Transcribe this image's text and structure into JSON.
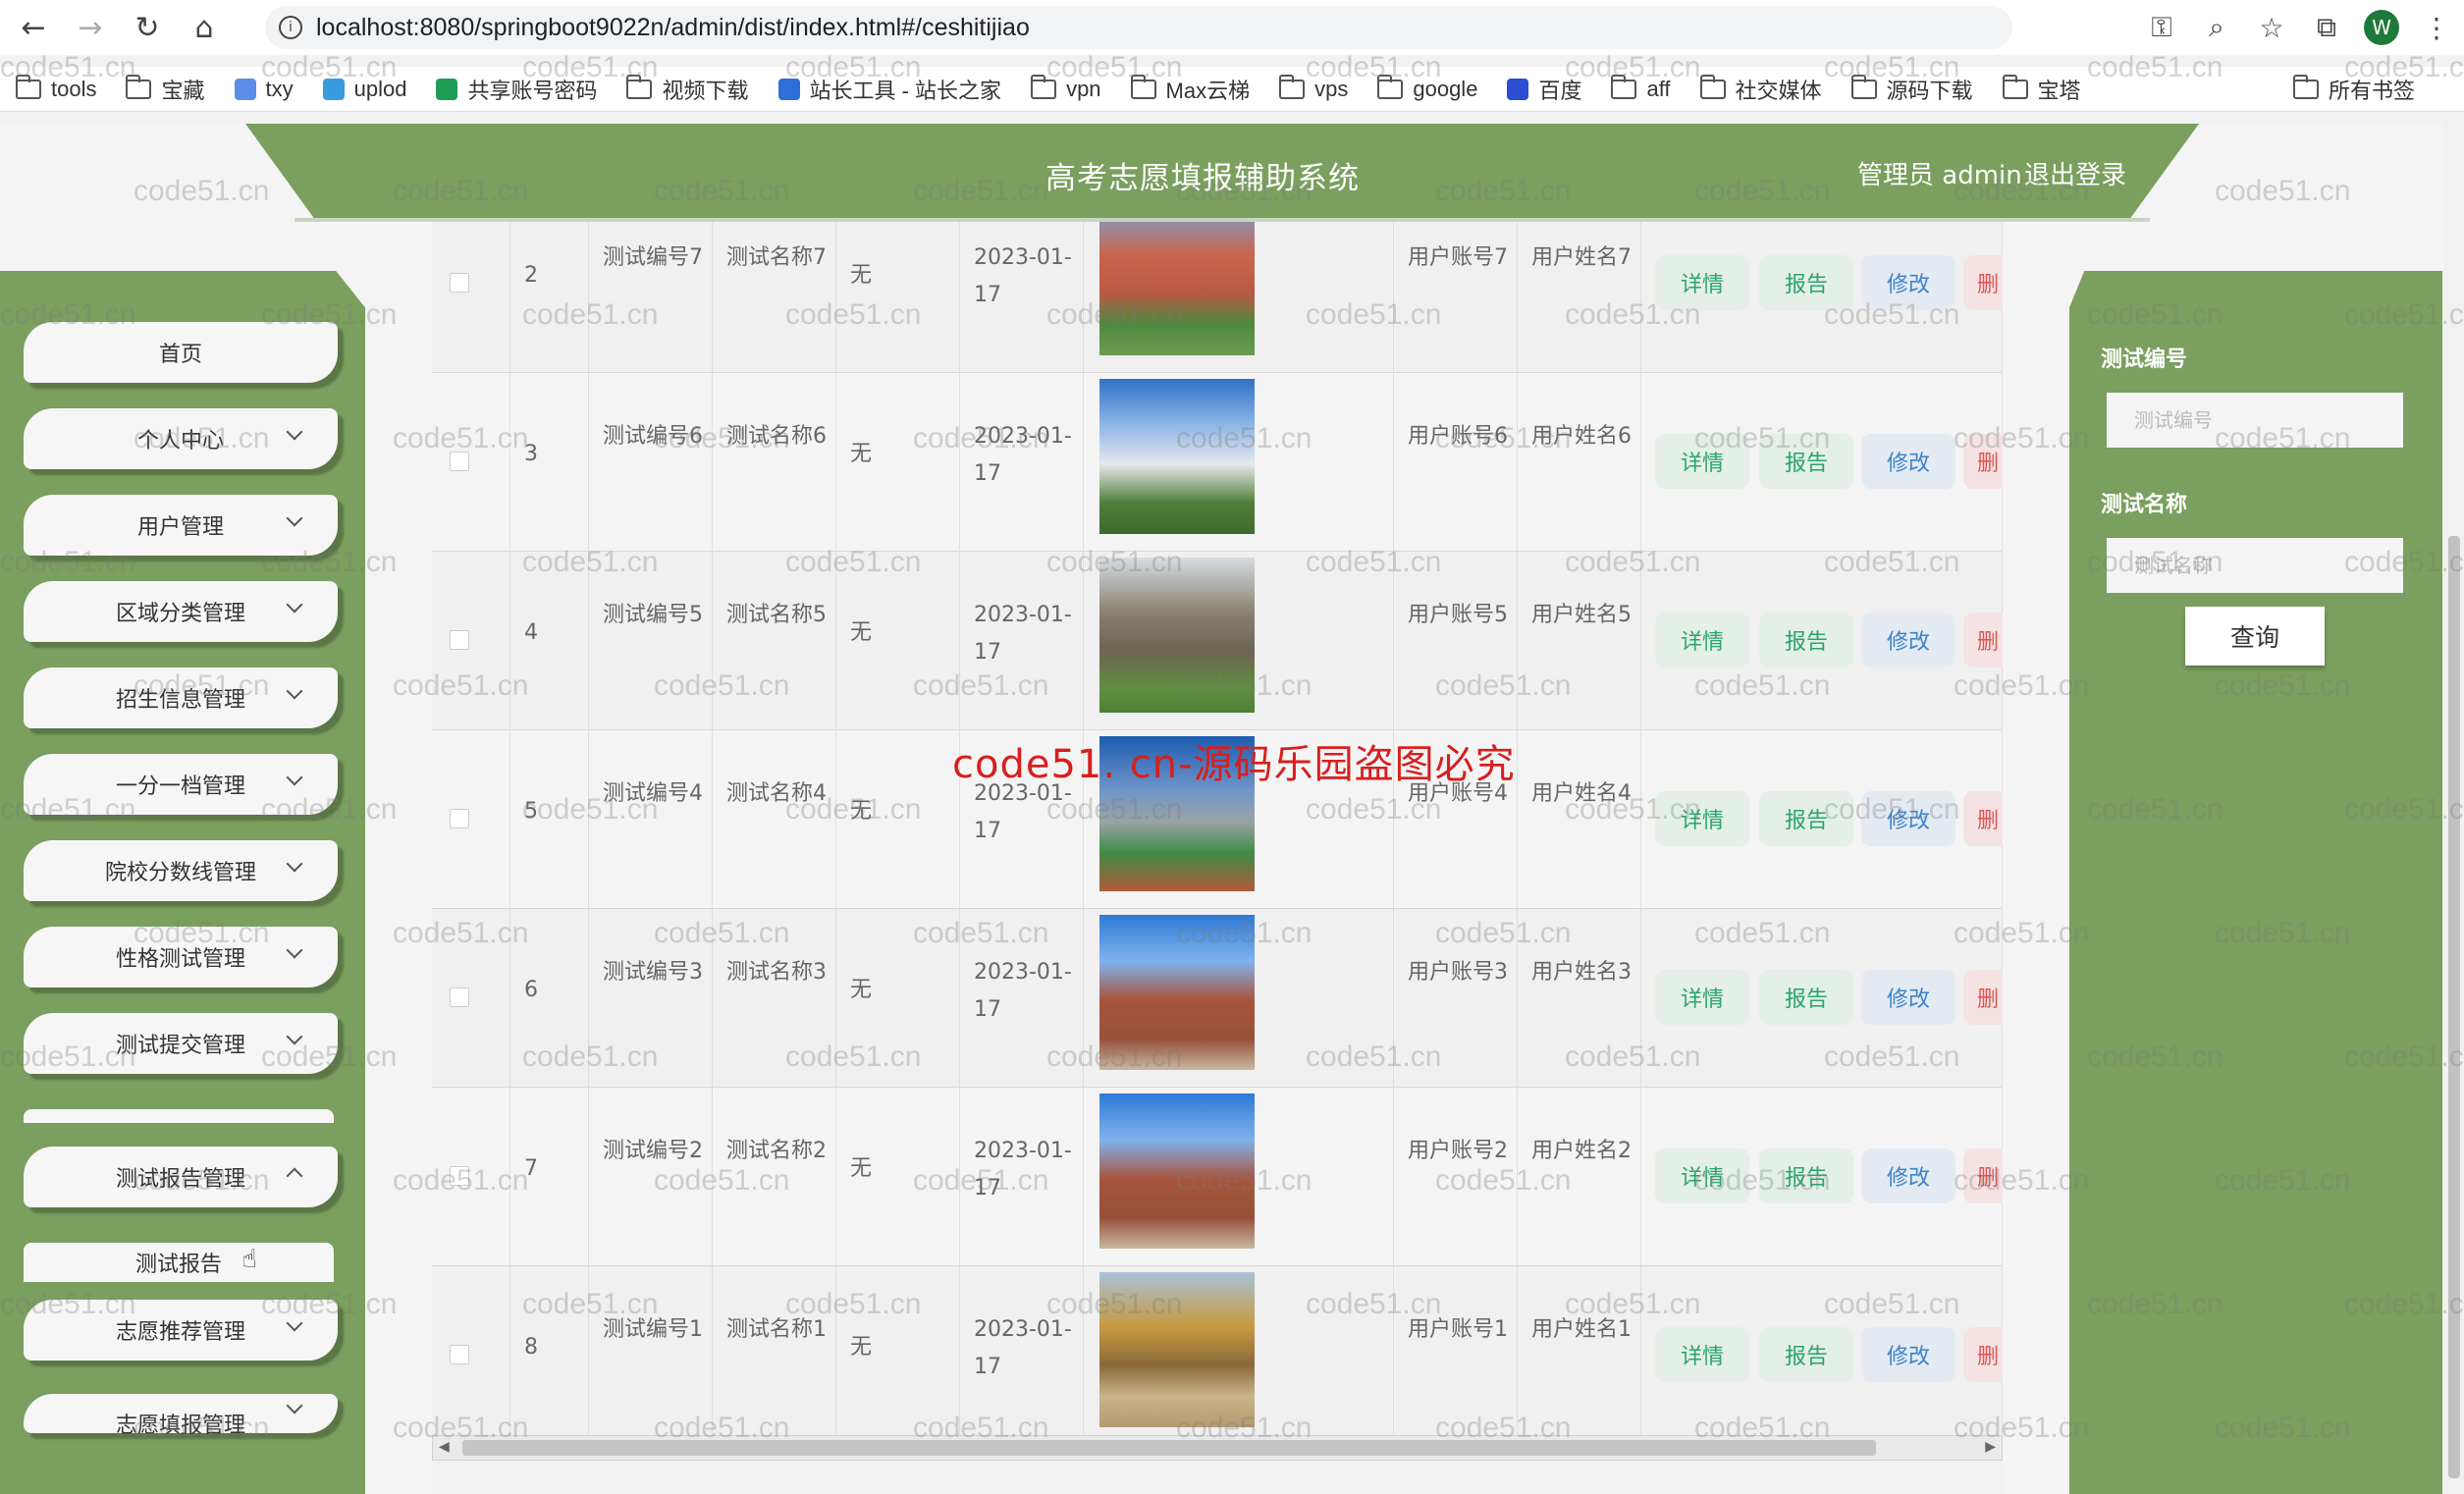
{
  "browser": {
    "url": "localhost:8080/springboot9022n/admin/dist/index.html#/ceshitijiao",
    "profile_initial": "W",
    "bookmarks": [
      "tools",
      "宝藏",
      "txy",
      "uplod",
      "共享账号密码",
      "视频下载",
      "站长工具 - 站长之家",
      "vpn",
      "Max云梯",
      "vps",
      "google",
      "百度",
      "aff",
      "社交媒体",
      "源码下载",
      "宝塔"
    ],
    "all_bookmarks": "所有书签"
  },
  "header": {
    "title": "高考志愿填报辅助系统",
    "user": "管理员 admin",
    "logout": "退出登录"
  },
  "sidebar": {
    "items": [
      "首页",
      "个人中心",
      "用户管理",
      "区域分类管理",
      "招生信息管理",
      "一分一档管理",
      "院校分数线管理",
      "性格测试管理",
      "测试提交管理",
      "测试报告管理",
      "志愿推荐管理",
      "志愿填报管理"
    ],
    "sub_item": "测试报告"
  },
  "table": {
    "rows": [
      {
        "index": "2",
        "code": "测试编号7",
        "name": "测试名称7",
        "remark": "无",
        "date": "2023-01-17",
        "account": "用户账号7",
        "username": "用户姓名7"
      },
      {
        "index": "3",
        "code": "测试编号6",
        "name": "测试名称6",
        "remark": "无",
        "date": "2023-01-17",
        "account": "用户账号6",
        "username": "用户姓名6"
      },
      {
        "index": "4",
        "code": "测试编号5",
        "name": "测试名称5",
        "remark": "无",
        "date": "2023-01-17",
        "account": "用户账号5",
        "username": "用户姓名5"
      },
      {
        "index": "5",
        "code": "测试编号4",
        "name": "测试名称4",
        "remark": "无",
        "date": "2023-01-17",
        "account": "用户账号4",
        "username": "用户姓名4"
      },
      {
        "index": "6",
        "code": "测试编号3",
        "name": "测试名称3",
        "remark": "无",
        "date": "2023-01-17",
        "account": "用户账号3",
        "username": "用户姓名3"
      },
      {
        "index": "7",
        "code": "测试编号2",
        "name": "测试名称2",
        "remark": "无",
        "date": "2023-01-17",
        "account": "用户账号2",
        "username": "用户姓名2"
      },
      {
        "index": "8",
        "code": "测试编号1",
        "name": "测试名称1",
        "remark": "无",
        "date": "2023-01-17",
        "account": "用户账号1",
        "username": "用户姓名1"
      }
    ],
    "actions": {
      "detail": "详情",
      "report": "报告",
      "edit": "修改",
      "delete": "删"
    }
  },
  "search": {
    "code_label": "测试编号",
    "code_placeholder": "测试编号",
    "name_label": "测试名称",
    "name_placeholder": "测试名称",
    "button": "查询"
  },
  "watermark": {
    "text": "code51.cn",
    "center_text": "code51. cn-源码乐园盗图必究"
  },
  "colors": {
    "theme_green": "#7a9f5e",
    "action_green": "#2aa56a",
    "action_blue": "#3d83c9",
    "action_red": "#e05252",
    "watermark_red": "#d81e1e"
  }
}
